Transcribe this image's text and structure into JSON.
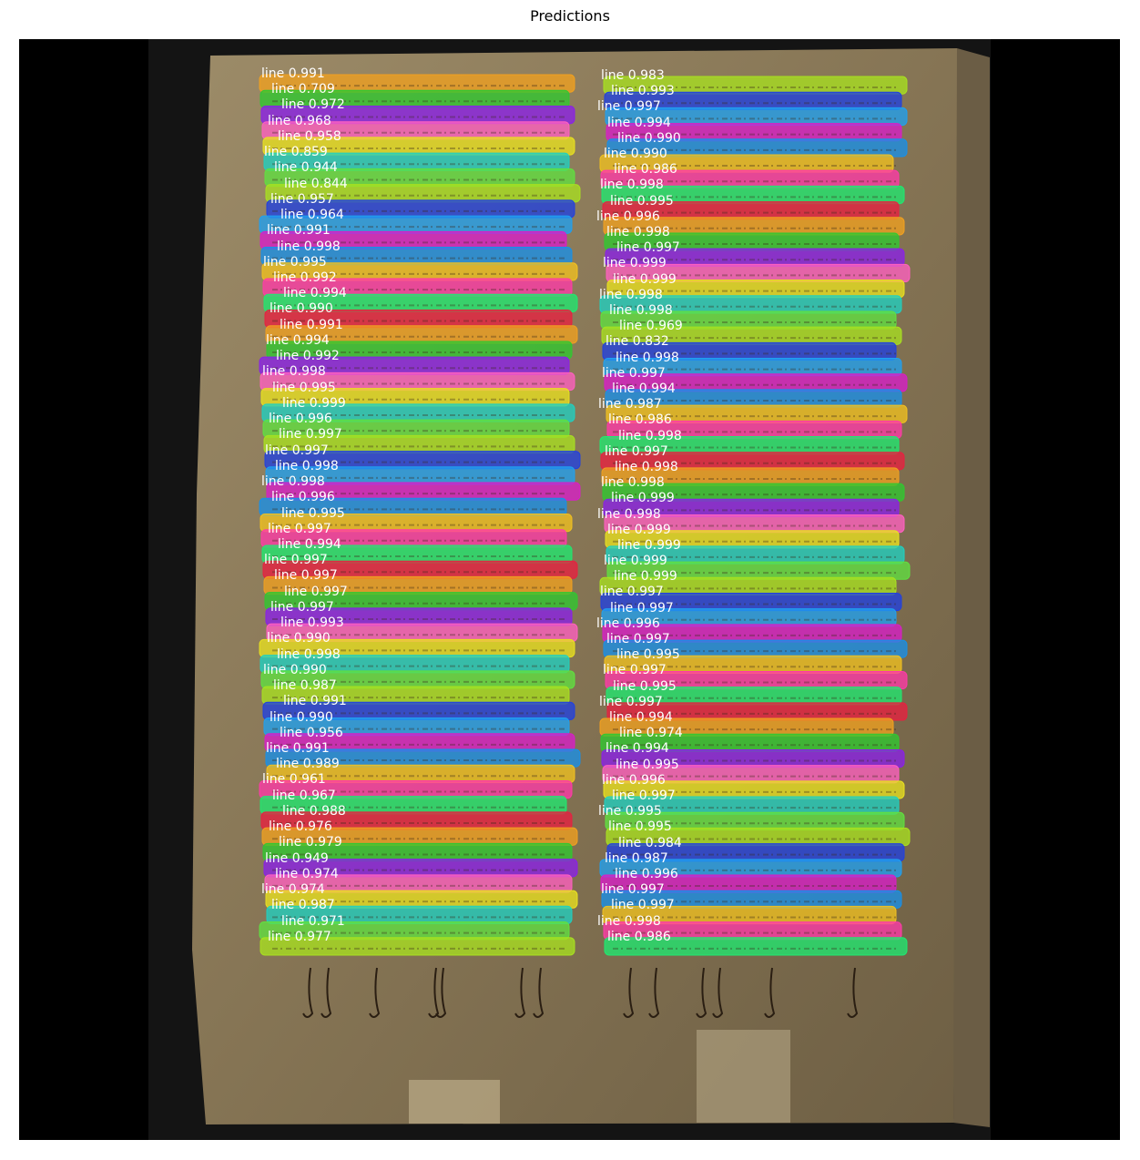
{
  "title": "Predictions",
  "colors": {
    "panel_bg": "#000000",
    "parchment": "#8a7a5c",
    "ink_lines": "#3b2a1a",
    "label_text": "#ffffff"
  },
  "palette": [
    "#f0a020",
    "#ff3aa8",
    "#d81ec8",
    "#a8e020",
    "#e8e020",
    "#30c830",
    "#20e870",
    "#1890e8",
    "#2040e0",
    "#20d0c0",
    "#8a20e8",
    "#e82040",
    "#f0c020",
    "#20a0f0",
    "#60e040",
    "#ff60c0"
  ],
  "columns": [
    {
      "name": "left",
      "detections": [
        {
          "label": "line",
          "score": "0.991"
        },
        {
          "label": "line",
          "score": "0.709"
        },
        {
          "label": "line",
          "score": "0.972"
        },
        {
          "label": "line",
          "score": "0.968"
        },
        {
          "label": "line",
          "score": "0.958"
        },
        {
          "label": "line",
          "score": "0.859"
        },
        {
          "label": "line",
          "score": "0.944"
        },
        {
          "label": "line",
          "score": "0.844"
        },
        {
          "label": "line",
          "score": "0.957"
        },
        {
          "label": "line",
          "score": "0.964"
        },
        {
          "label": "line",
          "score": "0.991"
        },
        {
          "label": "line",
          "score": "0.998"
        },
        {
          "label": "line",
          "score": "0.995"
        },
        {
          "label": "line",
          "score": "0.992"
        },
        {
          "label": "line",
          "score": "0.994"
        },
        {
          "label": "line",
          "score": "0.990"
        },
        {
          "label": "line",
          "score": "0.991"
        },
        {
          "label": "line",
          "score": "0.994"
        },
        {
          "label": "line",
          "score": "0.992"
        },
        {
          "label": "line",
          "score": "0.998"
        },
        {
          "label": "line",
          "score": "0.995"
        },
        {
          "label": "line",
          "score": "0.999"
        },
        {
          "label": "line",
          "score": "0.996"
        },
        {
          "label": "line",
          "score": "0.997"
        },
        {
          "label": "line",
          "score": "0.997"
        },
        {
          "label": "line",
          "score": "0.998"
        },
        {
          "label": "line",
          "score": "0.998"
        },
        {
          "label": "line",
          "score": "0.996"
        },
        {
          "label": "line",
          "score": "0.995"
        },
        {
          "label": "line",
          "score": "0.997"
        },
        {
          "label": "line",
          "score": "0.994"
        },
        {
          "label": "line",
          "score": "0.997"
        },
        {
          "label": "line",
          "score": "0.997"
        },
        {
          "label": "line",
          "score": "0.997"
        },
        {
          "label": "line",
          "score": "0.997"
        },
        {
          "label": "line",
          "score": "0.993"
        },
        {
          "label": "line",
          "score": "0.990"
        },
        {
          "label": "line",
          "score": "0.998"
        },
        {
          "label": "line",
          "score": "0.990"
        },
        {
          "label": "line",
          "score": "0.987"
        },
        {
          "label": "line",
          "score": "0.991"
        },
        {
          "label": "line",
          "score": "0.990"
        },
        {
          "label": "line",
          "score": "0.956"
        },
        {
          "label": "line",
          "score": "0.991"
        },
        {
          "label": "line",
          "score": "0.989"
        },
        {
          "label": "line",
          "score": "0.961"
        },
        {
          "label": "line",
          "score": "0.967"
        },
        {
          "label": "line",
          "score": "0.988"
        },
        {
          "label": "line",
          "score": "0.976"
        },
        {
          "label": "line",
          "score": "0.979"
        },
        {
          "label": "line",
          "score": "0.949"
        },
        {
          "label": "line",
          "score": "0.974"
        },
        {
          "label": "line",
          "score": "0.974"
        },
        {
          "label": "line",
          "score": "0.987"
        },
        {
          "label": "line",
          "score": "0.971"
        },
        {
          "label": "line",
          "score": "0.977"
        }
      ]
    },
    {
      "name": "right",
      "detections": [
        {
          "label": "line",
          "score": "0.983"
        },
        {
          "label": "line",
          "score": "0.993"
        },
        {
          "label": "line",
          "score": "0.997"
        },
        {
          "label": "line",
          "score": "0.994"
        },
        {
          "label": "line",
          "score": "0.990"
        },
        {
          "label": "line",
          "score": "0.990"
        },
        {
          "label": "line",
          "score": "0.986"
        },
        {
          "label": "line",
          "score": "0.998"
        },
        {
          "label": "line",
          "score": "0.995"
        },
        {
          "label": "line",
          "score": "0.996"
        },
        {
          "label": "line",
          "score": "0.998"
        },
        {
          "label": "line",
          "score": "0.997"
        },
        {
          "label": "line",
          "score": "0.999"
        },
        {
          "label": "line",
          "score": "0.999"
        },
        {
          "label": "line",
          "score": "0.998"
        },
        {
          "label": "line",
          "score": "0.998"
        },
        {
          "label": "line",
          "score": "0.969"
        },
        {
          "label": "line",
          "score": "0.832"
        },
        {
          "label": "line",
          "score": "0.998"
        },
        {
          "label": "line",
          "score": "0.997"
        },
        {
          "label": "line",
          "score": "0.994"
        },
        {
          "label": "line",
          "score": "0.987"
        },
        {
          "label": "line",
          "score": "0.986"
        },
        {
          "label": "line",
          "score": "0.998"
        },
        {
          "label": "line",
          "score": "0.997"
        },
        {
          "label": "line",
          "score": "0.998"
        },
        {
          "label": "line",
          "score": "0.998"
        },
        {
          "label": "line",
          "score": "0.999"
        },
        {
          "label": "line",
          "score": "0.998"
        },
        {
          "label": "line",
          "score": "0.999"
        },
        {
          "label": "line",
          "score": "0.999"
        },
        {
          "label": "line",
          "score": "0.999"
        },
        {
          "label": "line",
          "score": "0.999"
        },
        {
          "label": "line",
          "score": "0.997"
        },
        {
          "label": "line",
          "score": "0.997"
        },
        {
          "label": "line",
          "score": "0.996"
        },
        {
          "label": "line",
          "score": "0.997"
        },
        {
          "label": "line",
          "score": "0.995"
        },
        {
          "label": "line",
          "score": "0.997"
        },
        {
          "label": "line",
          "score": "0.995"
        },
        {
          "label": "line",
          "score": "0.997"
        },
        {
          "label": "line",
          "score": "0.994"
        },
        {
          "label": "line",
          "score": "0.974"
        },
        {
          "label": "line",
          "score": "0.994"
        },
        {
          "label": "line",
          "score": "0.995"
        },
        {
          "label": "line",
          "score": "0.996"
        },
        {
          "label": "line",
          "score": "0.997"
        },
        {
          "label": "line",
          "score": "0.995"
        },
        {
          "label": "line",
          "score": "0.995"
        },
        {
          "label": "line",
          "score": "0.984"
        },
        {
          "label": "line",
          "score": "0.987"
        },
        {
          "label": "line",
          "score": "0.996"
        },
        {
          "label": "line",
          "score": "0.997"
        },
        {
          "label": "line",
          "score": "0.997"
        },
        {
          "label": "line",
          "score": "0.998"
        },
        {
          "label": "line",
          "score": "0.986"
        }
      ]
    }
  ]
}
